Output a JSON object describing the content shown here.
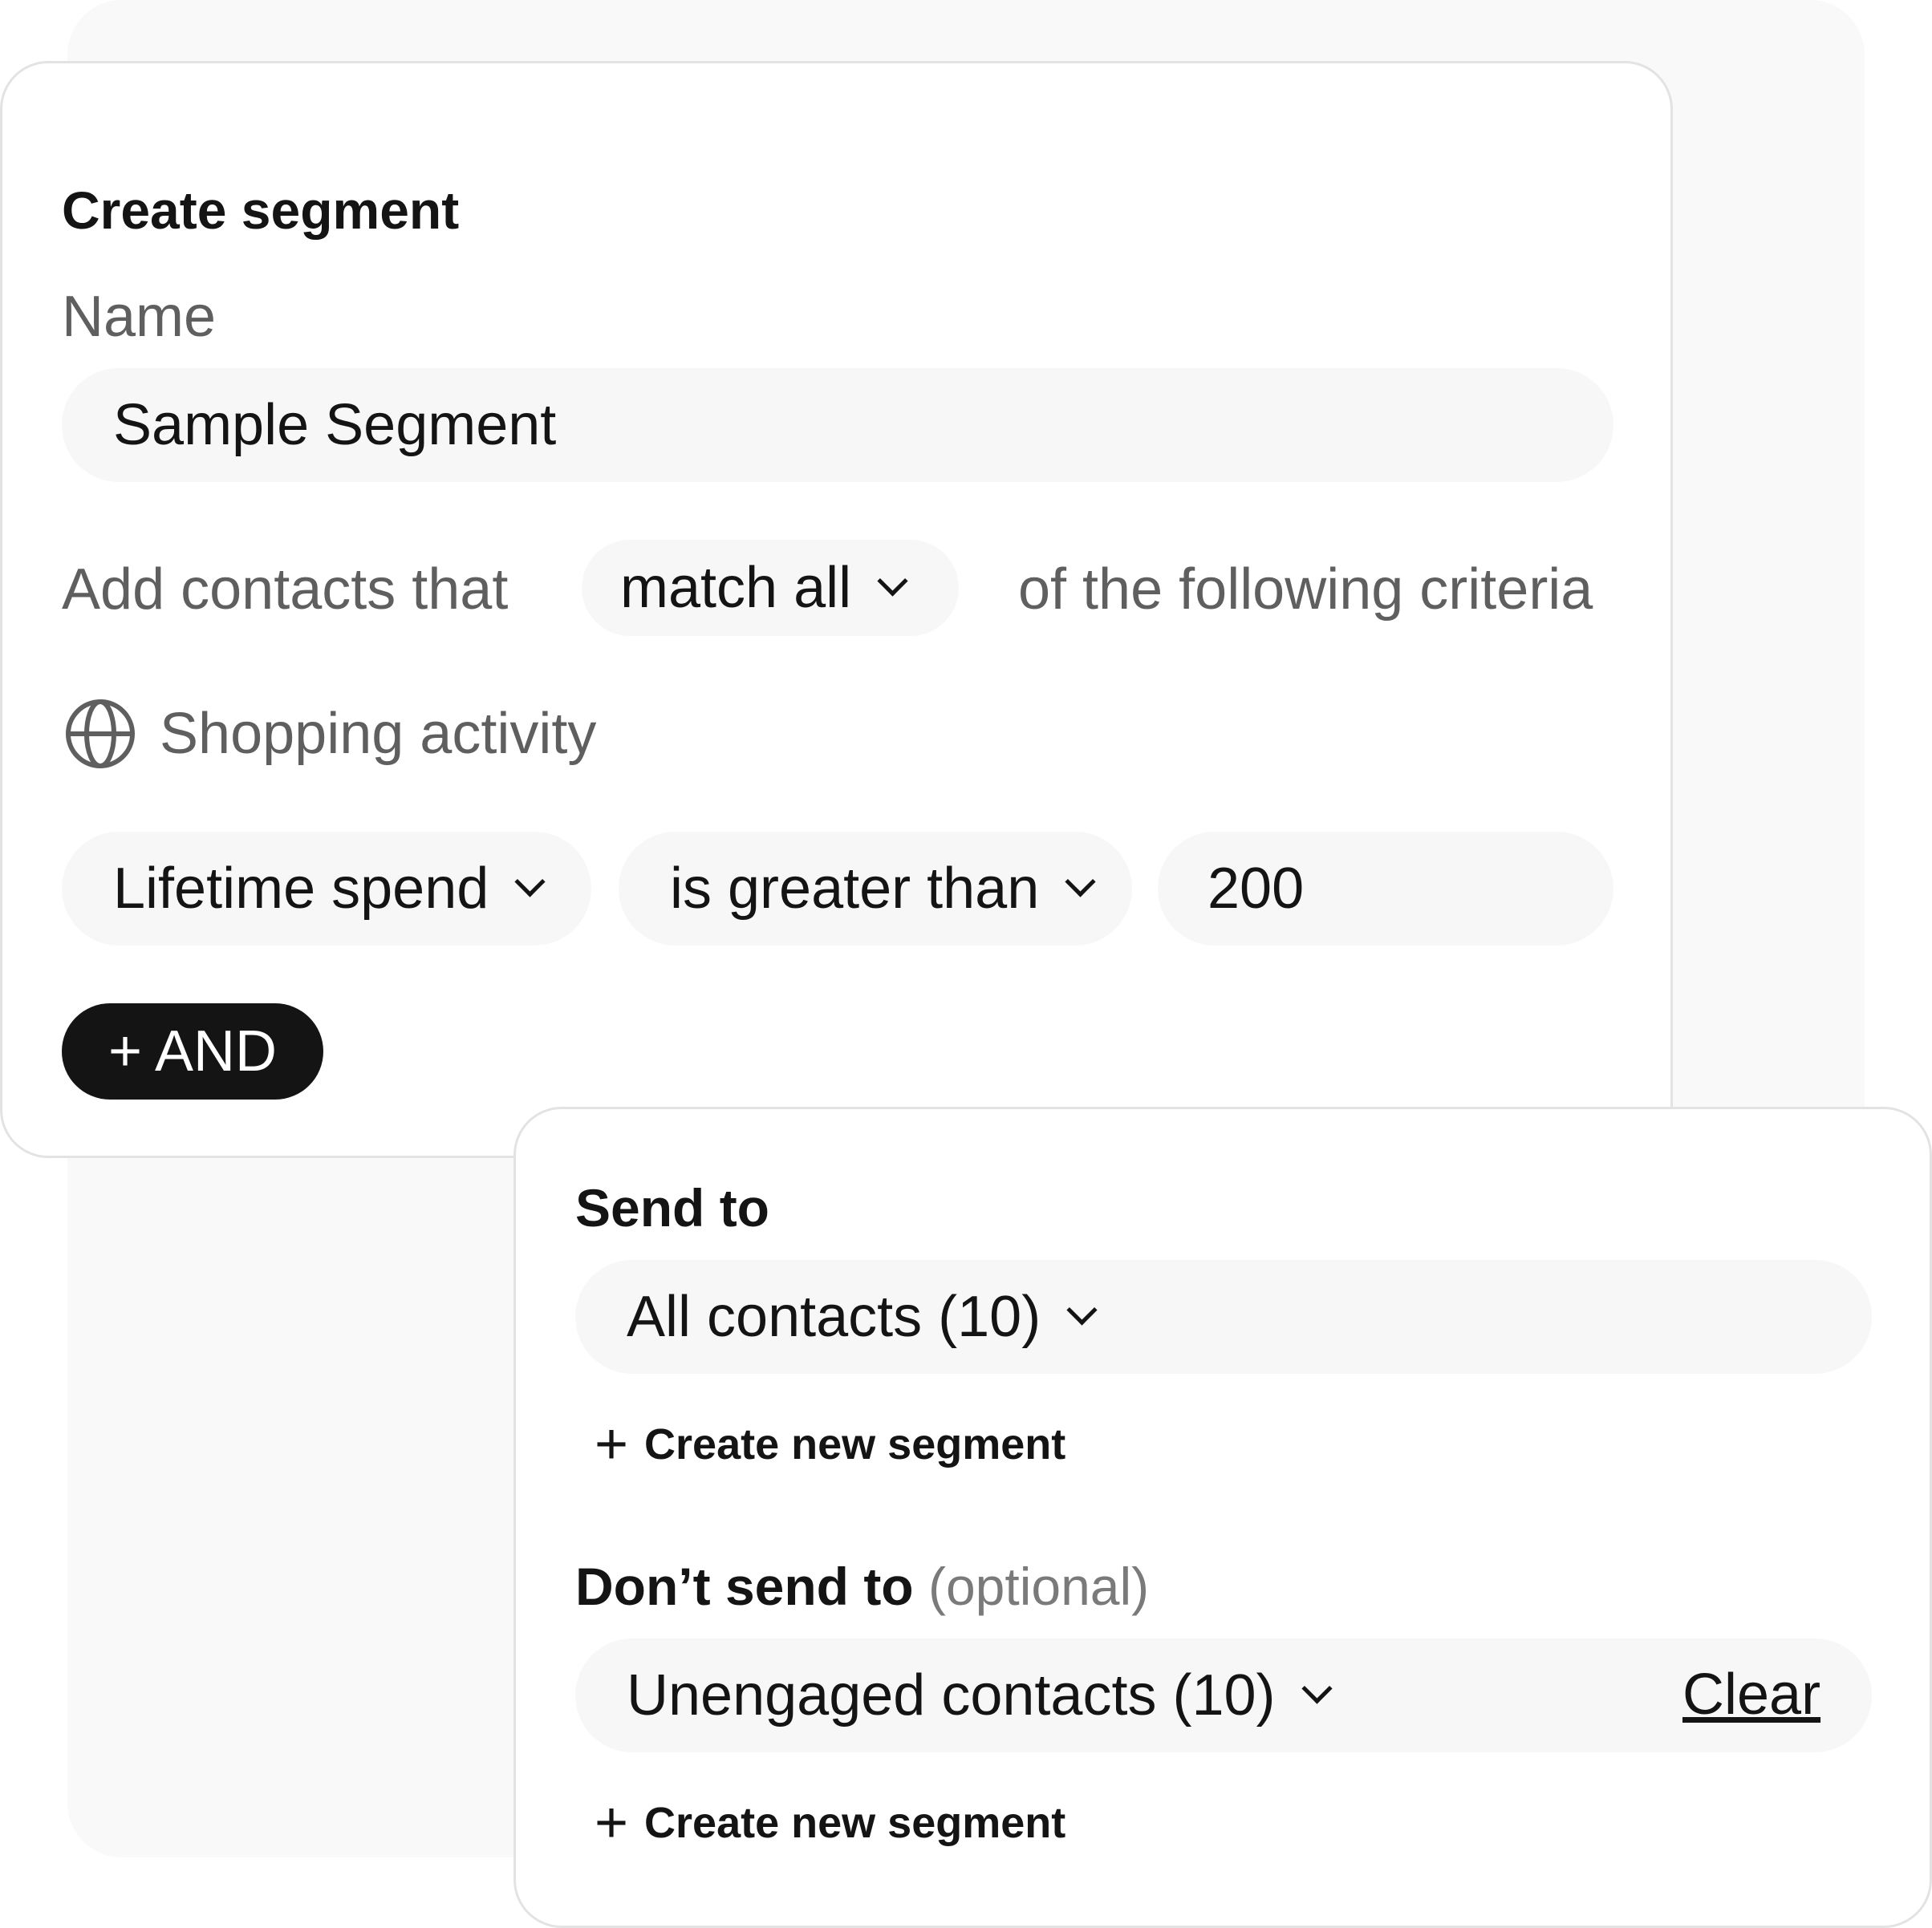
{
  "segment_card": {
    "title": "Create segment",
    "name_label": "Name",
    "name_value": "Sample Segment",
    "criteria_prefix": "Add contacts that",
    "match_select": "match all",
    "criteria_suffix": "of the following criteria",
    "group_icon": "globe-icon",
    "group_label": "Shopping activity",
    "rule": {
      "field": "Lifetime spend",
      "operator": "is greater than",
      "value": "200"
    },
    "and_button": "+ AND"
  },
  "send_card": {
    "send_to_title": "Send to",
    "send_to_select": "All contacts (10)",
    "create_segment_link": "Create new segment",
    "dont_send_title": "Don’t send to",
    "dont_send_optional": "(optional)",
    "dont_send_select": "Unengaged contacts (10)",
    "clear_link": "Clear",
    "create_segment_link_2": "Create new segment"
  },
  "colors": {
    "accent": "#141414",
    "muted_text": "#5f5f5f",
    "field_background": "#f7f7f7",
    "background_card": "#f9f9f9"
  }
}
